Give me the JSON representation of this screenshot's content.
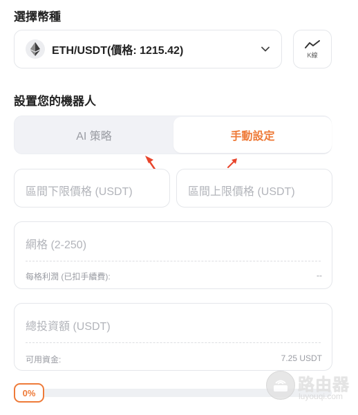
{
  "coin_section": {
    "title": "選擇幣種"
  },
  "coin_select": {
    "value": "ETH/USDT(價格: 1215.42)",
    "icon": "eth-icon"
  },
  "kline_button": {
    "label": "K線",
    "icon": "line-chart-icon"
  },
  "bot_section": {
    "title": "設置您的機器人"
  },
  "tabs": [
    {
      "label": "AI 策略",
      "active": false
    },
    {
      "label": "手動設定",
      "active": true
    }
  ],
  "price_range": {
    "lower_placeholder": "區間下限價格 (USDT)",
    "upper_placeholder": "區間上限價格 (USDT)"
  },
  "grid": {
    "placeholder": "網格 (2-250)",
    "profit_label": "每格利潤 (已扣手續費):",
    "profit_value": "--"
  },
  "investment": {
    "placeholder": "總投資額 (USDT)",
    "available_label": "可用資金:",
    "available_value": "7.25 USDT"
  },
  "allocation": {
    "percent_label": "0%",
    "fraction": 0
  },
  "watermark": {
    "cn": "路由器",
    "en": "luyouqi.com"
  },
  "colors": {
    "accent": "#ee7a38",
    "annotation_arrow": "#e8452c",
    "border": "#e4e6ea",
    "placeholder": "#b2b4ba"
  }
}
